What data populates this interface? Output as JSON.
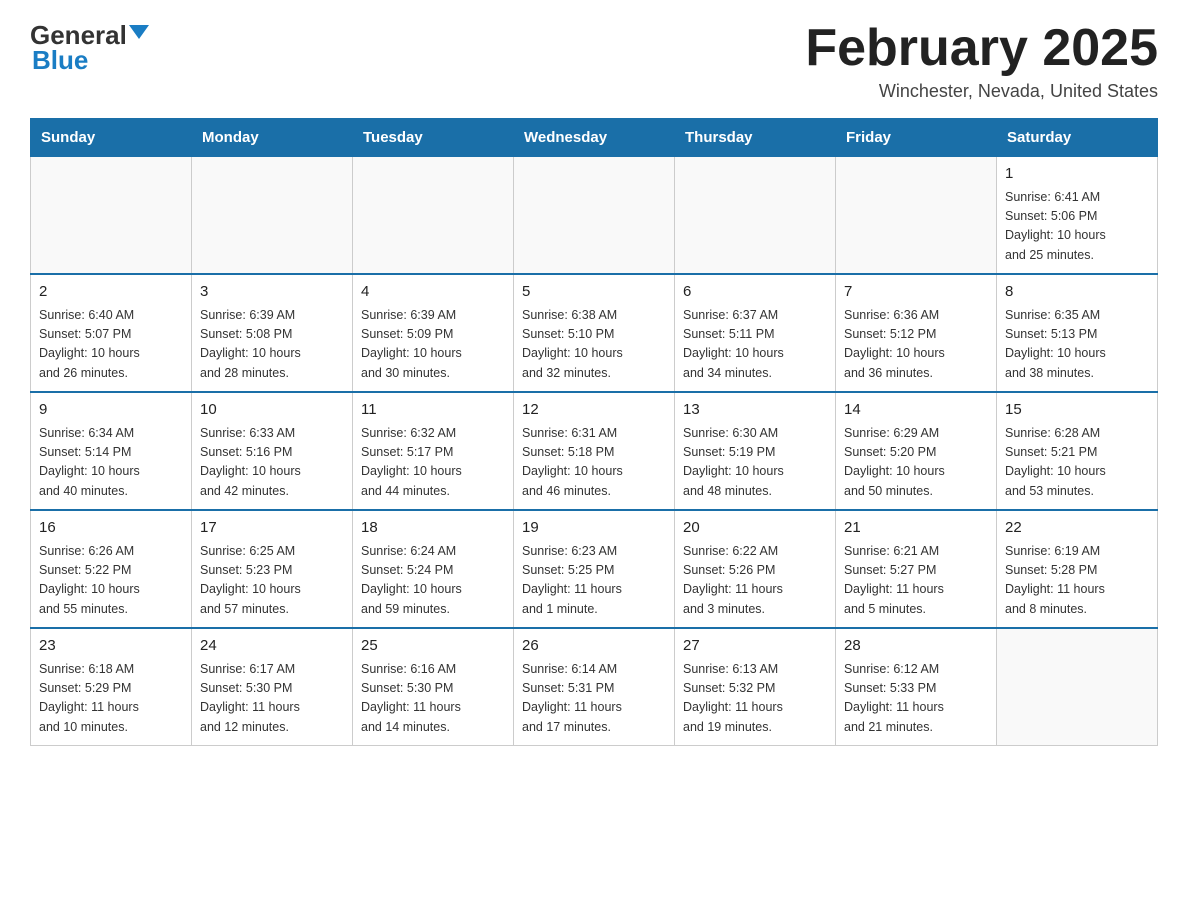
{
  "header": {
    "logo_general": "General",
    "logo_blue": "Blue",
    "month_title": "February 2025",
    "location": "Winchester, Nevada, United States"
  },
  "days_of_week": [
    "Sunday",
    "Monday",
    "Tuesday",
    "Wednesday",
    "Thursday",
    "Friday",
    "Saturday"
  ],
  "weeks": [
    [
      {
        "day": "",
        "info": ""
      },
      {
        "day": "",
        "info": ""
      },
      {
        "day": "",
        "info": ""
      },
      {
        "day": "",
        "info": ""
      },
      {
        "day": "",
        "info": ""
      },
      {
        "day": "",
        "info": ""
      },
      {
        "day": "1",
        "info": "Sunrise: 6:41 AM\nSunset: 5:06 PM\nDaylight: 10 hours\nand 25 minutes."
      }
    ],
    [
      {
        "day": "2",
        "info": "Sunrise: 6:40 AM\nSunset: 5:07 PM\nDaylight: 10 hours\nand 26 minutes."
      },
      {
        "day": "3",
        "info": "Sunrise: 6:39 AM\nSunset: 5:08 PM\nDaylight: 10 hours\nand 28 minutes."
      },
      {
        "day": "4",
        "info": "Sunrise: 6:39 AM\nSunset: 5:09 PM\nDaylight: 10 hours\nand 30 minutes."
      },
      {
        "day": "5",
        "info": "Sunrise: 6:38 AM\nSunset: 5:10 PM\nDaylight: 10 hours\nand 32 minutes."
      },
      {
        "day": "6",
        "info": "Sunrise: 6:37 AM\nSunset: 5:11 PM\nDaylight: 10 hours\nand 34 minutes."
      },
      {
        "day": "7",
        "info": "Sunrise: 6:36 AM\nSunset: 5:12 PM\nDaylight: 10 hours\nand 36 minutes."
      },
      {
        "day": "8",
        "info": "Sunrise: 6:35 AM\nSunset: 5:13 PM\nDaylight: 10 hours\nand 38 minutes."
      }
    ],
    [
      {
        "day": "9",
        "info": "Sunrise: 6:34 AM\nSunset: 5:14 PM\nDaylight: 10 hours\nand 40 minutes."
      },
      {
        "day": "10",
        "info": "Sunrise: 6:33 AM\nSunset: 5:16 PM\nDaylight: 10 hours\nand 42 minutes."
      },
      {
        "day": "11",
        "info": "Sunrise: 6:32 AM\nSunset: 5:17 PM\nDaylight: 10 hours\nand 44 minutes."
      },
      {
        "day": "12",
        "info": "Sunrise: 6:31 AM\nSunset: 5:18 PM\nDaylight: 10 hours\nand 46 minutes."
      },
      {
        "day": "13",
        "info": "Sunrise: 6:30 AM\nSunset: 5:19 PM\nDaylight: 10 hours\nand 48 minutes."
      },
      {
        "day": "14",
        "info": "Sunrise: 6:29 AM\nSunset: 5:20 PM\nDaylight: 10 hours\nand 50 minutes."
      },
      {
        "day": "15",
        "info": "Sunrise: 6:28 AM\nSunset: 5:21 PM\nDaylight: 10 hours\nand 53 minutes."
      }
    ],
    [
      {
        "day": "16",
        "info": "Sunrise: 6:26 AM\nSunset: 5:22 PM\nDaylight: 10 hours\nand 55 minutes."
      },
      {
        "day": "17",
        "info": "Sunrise: 6:25 AM\nSunset: 5:23 PM\nDaylight: 10 hours\nand 57 minutes."
      },
      {
        "day": "18",
        "info": "Sunrise: 6:24 AM\nSunset: 5:24 PM\nDaylight: 10 hours\nand 59 minutes."
      },
      {
        "day": "19",
        "info": "Sunrise: 6:23 AM\nSunset: 5:25 PM\nDaylight: 11 hours\nand 1 minute."
      },
      {
        "day": "20",
        "info": "Sunrise: 6:22 AM\nSunset: 5:26 PM\nDaylight: 11 hours\nand 3 minutes."
      },
      {
        "day": "21",
        "info": "Sunrise: 6:21 AM\nSunset: 5:27 PM\nDaylight: 11 hours\nand 5 minutes."
      },
      {
        "day": "22",
        "info": "Sunrise: 6:19 AM\nSunset: 5:28 PM\nDaylight: 11 hours\nand 8 minutes."
      }
    ],
    [
      {
        "day": "23",
        "info": "Sunrise: 6:18 AM\nSunset: 5:29 PM\nDaylight: 11 hours\nand 10 minutes."
      },
      {
        "day": "24",
        "info": "Sunrise: 6:17 AM\nSunset: 5:30 PM\nDaylight: 11 hours\nand 12 minutes."
      },
      {
        "day": "25",
        "info": "Sunrise: 6:16 AM\nSunset: 5:30 PM\nDaylight: 11 hours\nand 14 minutes."
      },
      {
        "day": "26",
        "info": "Sunrise: 6:14 AM\nSunset: 5:31 PM\nDaylight: 11 hours\nand 17 minutes."
      },
      {
        "day": "27",
        "info": "Sunrise: 6:13 AM\nSunset: 5:32 PM\nDaylight: 11 hours\nand 19 minutes."
      },
      {
        "day": "28",
        "info": "Sunrise: 6:12 AM\nSunset: 5:33 PM\nDaylight: 11 hours\nand 21 minutes."
      },
      {
        "day": "",
        "info": ""
      }
    ]
  ]
}
